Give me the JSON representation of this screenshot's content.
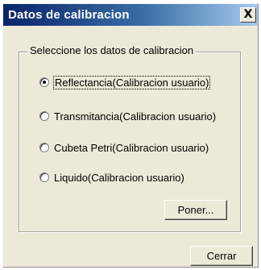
{
  "window": {
    "title": "Datos de calibracion",
    "close_glyph": "X"
  },
  "group": {
    "label": "Seleccione los datos de calibracion"
  },
  "options": [
    {
      "label": "Reflectancia(Calibracion usuario)",
      "checked": true
    },
    {
      "label": "Transmitancia(Calibracion usuario)",
      "checked": false
    },
    {
      "label": "Cubeta Petri(Calibracion usuario)",
      "checked": false
    },
    {
      "label": "Liquido(Calibracion usuario)",
      "checked": false
    }
  ],
  "buttons": {
    "poner": "Poner...",
    "cerrar": "Cerrar"
  },
  "colors": {
    "titlebar_start": "#0a246a",
    "titlebar_end": "#a6caf0",
    "face": "#ece9d8"
  }
}
